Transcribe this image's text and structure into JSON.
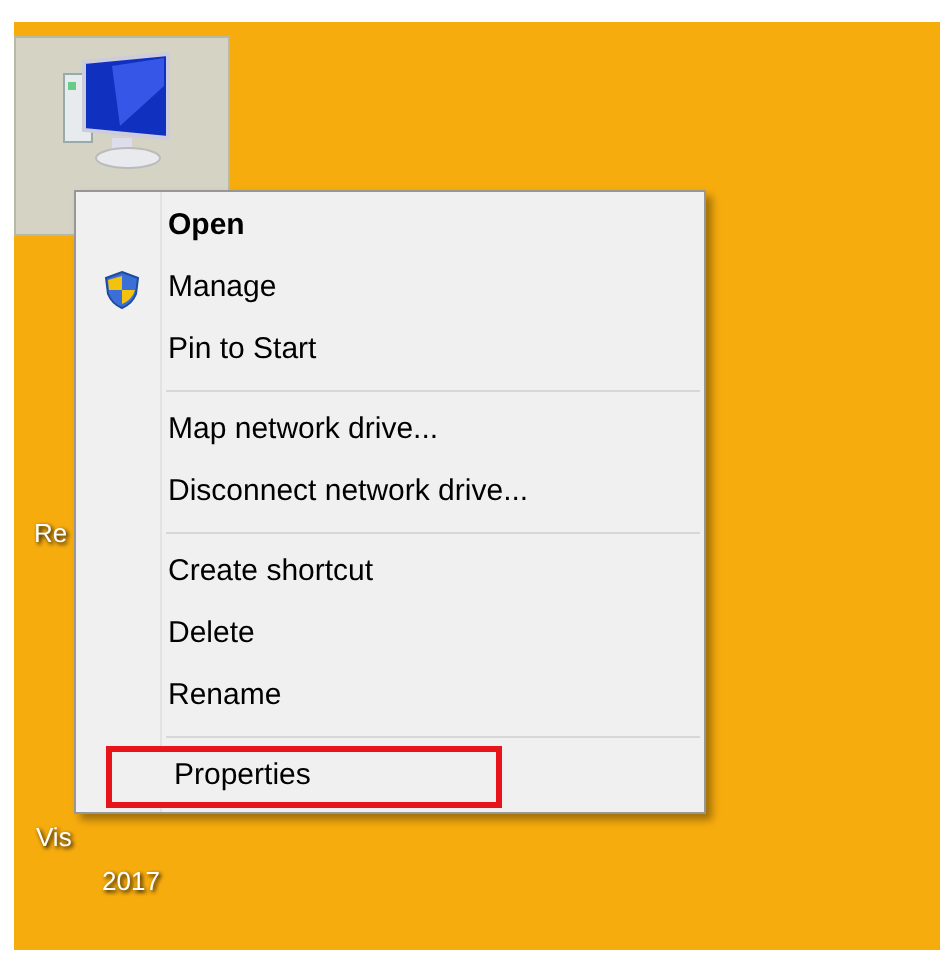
{
  "desktop": {
    "icons": [
      {
        "label": "Re"
      },
      {
        "label": "Vis"
      },
      {
        "label": "2017"
      }
    ]
  },
  "context_menu": {
    "groups": [
      [
        {
          "label": "Open",
          "default": true,
          "shield": false,
          "highlighted": false
        },
        {
          "label": "Manage",
          "default": false,
          "shield": true,
          "highlighted": false
        },
        {
          "label": "Pin to Start",
          "default": false,
          "shield": false,
          "highlighted": false
        }
      ],
      [
        {
          "label": "Map network drive...",
          "default": false,
          "shield": false,
          "highlighted": false
        },
        {
          "label": "Disconnect network drive...",
          "default": false,
          "shield": false,
          "highlighted": false
        }
      ],
      [
        {
          "label": "Create shortcut",
          "default": false,
          "shield": false,
          "highlighted": false
        },
        {
          "label": "Delete",
          "default": false,
          "shield": false,
          "highlighted": false
        },
        {
          "label": "Rename",
          "default": false,
          "shield": false,
          "highlighted": false
        }
      ],
      [
        {
          "label": "Properties",
          "default": false,
          "shield": false,
          "highlighted": true
        }
      ]
    ]
  }
}
